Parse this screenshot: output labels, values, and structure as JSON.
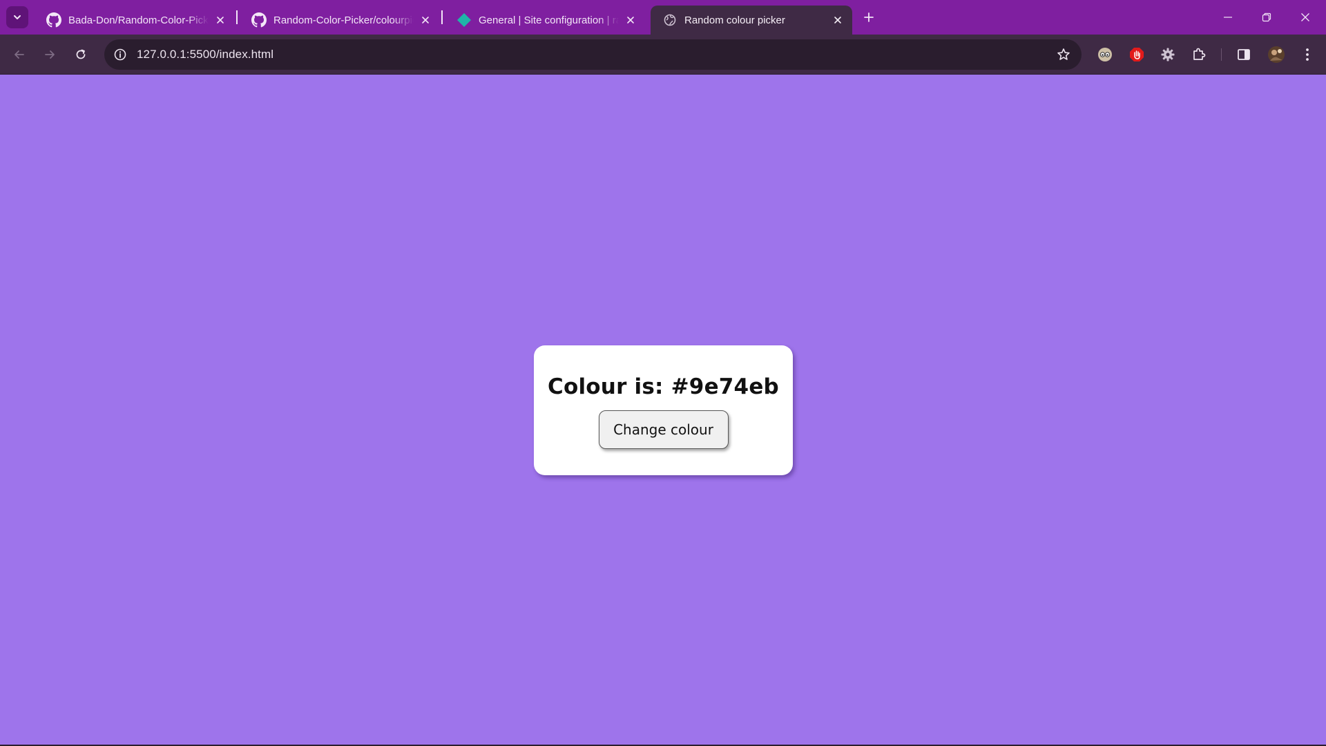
{
  "browser": {
    "tabs": [
      {
        "title": "Bada-Don/Random-Color-Picker",
        "icon": "github-icon",
        "active": false
      },
      {
        "title": "Random-Color-Picker/colourpicker",
        "icon": "github-icon",
        "active": false
      },
      {
        "title": "General | Site configuration | random",
        "icon": "netlify-icon",
        "active": false
      },
      {
        "title": "Random colour picker",
        "icon": "globe-icon",
        "active": true
      }
    ],
    "address_bar": {
      "url": "127.0.0.1:5500/index.html"
    },
    "colors": {
      "frame": "#7f1fa0",
      "toolbar": "#3f2a45",
      "omnibox": "#2a1d2e"
    }
  },
  "page": {
    "background_color": "#9e74eb",
    "heading": "Colour is: #9e74eb",
    "button_label": "Change colour"
  }
}
